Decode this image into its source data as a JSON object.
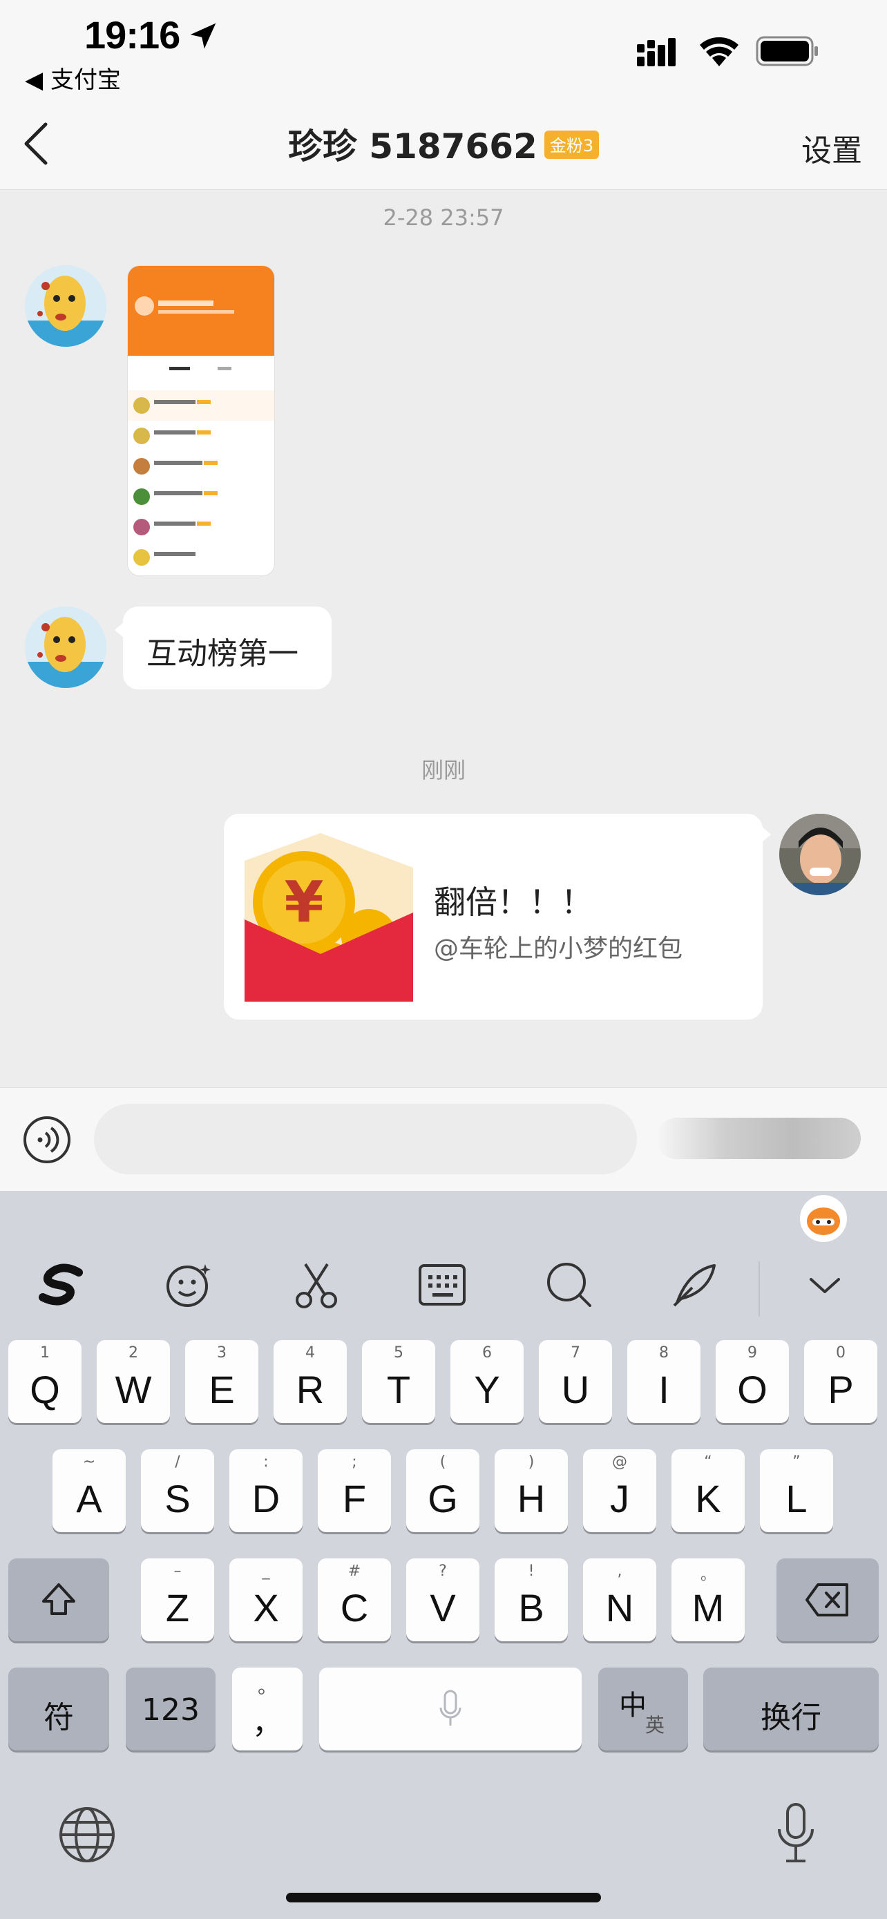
{
  "status_bar": {
    "time": "19:16",
    "back_app": "◀ 支付宝"
  },
  "nav": {
    "title": "珍珍 5187662",
    "badge": "金粉3",
    "settings": "设置"
  },
  "messages": {
    "timestamp_1": "2-28 23:57",
    "text_1": "互动榜第一",
    "timestamp_2": "刚刚",
    "redpacket_title": "翻倍！！！",
    "redpacket_sub": "@车轮上的小梦的红包"
  },
  "keyboard": {
    "row1": [
      {
        "k": "Q",
        "s": "1"
      },
      {
        "k": "W",
        "s": "2"
      },
      {
        "k": "E",
        "s": "3"
      },
      {
        "k": "R",
        "s": "4"
      },
      {
        "k": "T",
        "s": "5"
      },
      {
        "k": "Y",
        "s": "6"
      },
      {
        "k": "U",
        "s": "7"
      },
      {
        "k": "I",
        "s": "8"
      },
      {
        "k": "O",
        "s": "9"
      },
      {
        "k": "P",
        "s": "0"
      }
    ],
    "row2": [
      {
        "k": "A",
        "s": "~"
      },
      {
        "k": "S",
        "s": "/"
      },
      {
        "k": "D",
        "s": ":"
      },
      {
        "k": "F",
        "s": ";"
      },
      {
        "k": "G",
        "s": "("
      },
      {
        "k": "H",
        "s": ")"
      },
      {
        "k": "J",
        "s": "@"
      },
      {
        "k": "K",
        "s": "“"
      },
      {
        "k": "L",
        "s": "”"
      }
    ],
    "row3": [
      {
        "k": "Z",
        "s": "–"
      },
      {
        "k": "X",
        "s": "_"
      },
      {
        "k": "C",
        "s": "#"
      },
      {
        "k": "V",
        "s": "?"
      },
      {
        "k": "B",
        "s": "!"
      },
      {
        "k": "N",
        "s": ","
      },
      {
        "k": "M",
        "s": "。"
      }
    ],
    "fu": "符",
    "num": "123",
    "punct": "。",
    "punct2": "，",
    "zh": "中",
    "en": "英",
    "enter": "换行"
  },
  "colors": {
    "accent": "#f6b12c",
    "redpacket": "#e4283d",
    "coin": "#f5b400"
  },
  "icons": [
    "back-arrow-icon",
    "location-arrow-icon",
    "cellular-icon",
    "wifi-icon",
    "battery-icon",
    "voice-icon",
    "emoji-icon",
    "scissors-icon",
    "keyboard-icon",
    "search-icon",
    "pen-icon",
    "chevron-down-icon",
    "shift-icon",
    "delete-icon",
    "mic-icon",
    "globe-icon"
  ]
}
